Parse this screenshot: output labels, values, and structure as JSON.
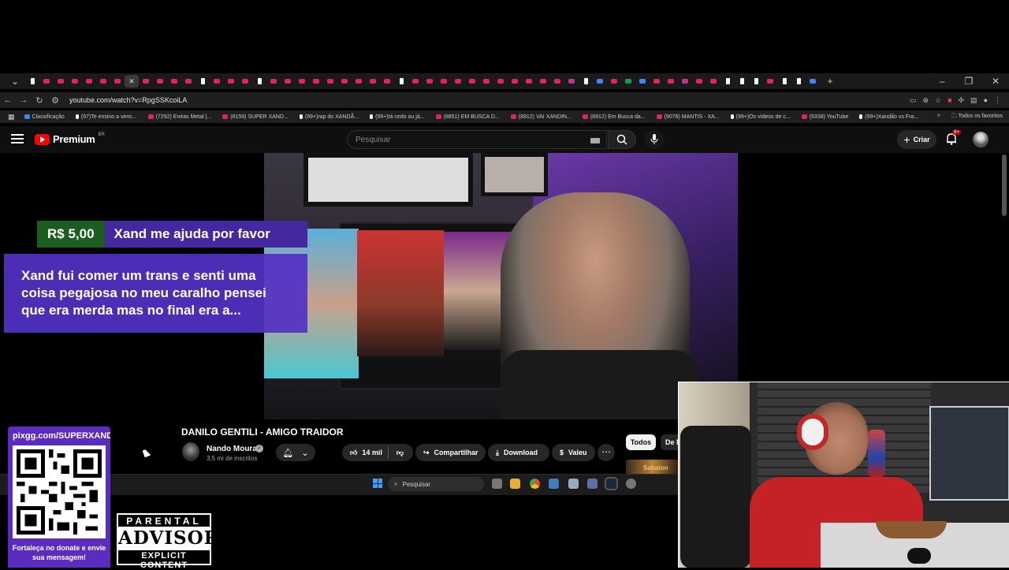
{
  "browser": {
    "url": "youtube.com/watch?v=RpgSSKcoiLA",
    "window_controls": [
      "–",
      "❐",
      "✕"
    ],
    "bookmarks": [
      {
        "label": "Classificação",
        "icon": "blue"
      },
      {
        "label": "(97)Te ensino a venc...",
        "icon": "tk"
      },
      {
        "label": "(7292) Enéas Metal |...",
        "icon": "yt"
      },
      {
        "label": "(8159) SUPER XAND...",
        "icon": "yt"
      },
      {
        "label": "(99+)rap do XANDÃ...",
        "icon": "tk"
      },
      {
        "label": "(99+)tá cedo ou já...",
        "icon": "tk"
      },
      {
        "label": "(8851) EM BUSCA D...",
        "icon": "yt"
      },
      {
        "label": "(8912) VAI XANDIN...",
        "icon": "yt"
      },
      {
        "label": "(8912) Em Busca da...",
        "icon": "yt"
      },
      {
        "label": "(9078) MANTIS - XA...",
        "icon": "yt"
      },
      {
        "label": "(99+)Os vídeos de c...",
        "icon": "tk"
      },
      {
        "label": "(9338) YouTube",
        "icon": "yt"
      },
      {
        "label": "(99+)Xandão vs Fra...",
        "icon": "tk"
      }
    ],
    "all_favorites": "Todos os favoritos"
  },
  "youtube": {
    "brand": "Premium",
    "country": "BR",
    "search_placeholder": "Pesquisar",
    "create_label": "Criar",
    "notif_badge": "9+"
  },
  "superchat": {
    "amount": "R$ 5,00",
    "name": "Xand me ajuda por favor",
    "message": "Xand fui comer um trans e senti uma coisa pegajosa no meu caralho pensei que era merda mas no final era a..."
  },
  "video": {
    "title": "DANILO GENTILI - AMIGO TRAIDOR",
    "channel": "Nando Moura",
    "subscribers": "3,5 mi de inscritos",
    "likes": "14 mil",
    "share": "Compartilhar",
    "download": "Download",
    "thanks": "Valeu",
    "chips": [
      "Todos",
      "De N"
    ],
    "related_thumb_text": "Sabaton"
  },
  "taskbar": {
    "search_label": "Pesquisar"
  },
  "overlay": {
    "qr_url": "pixgg.com/SUPERXANDÃO",
    "qr_caption": "Fortaleça no donate e envie sua mensagem!",
    "pa_top": "PARENTAL",
    "pa_mid": "ADVISORY",
    "pa_bot": "EXPLICIT CONTENT"
  }
}
